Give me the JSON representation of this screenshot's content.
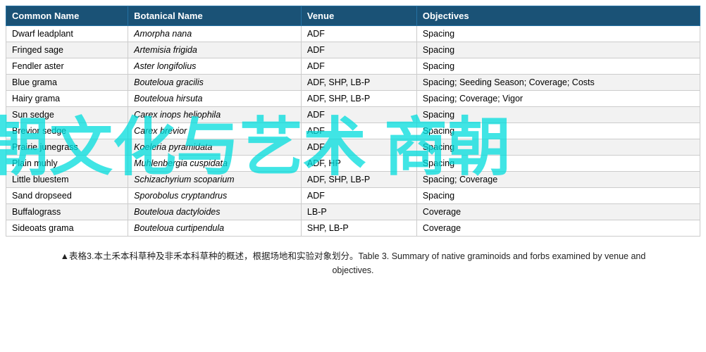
{
  "table": {
    "headers": [
      "Common Name",
      "Botanical  Name",
      "Venue",
      "Objectives"
    ],
    "rows": [
      [
        "Dwarf leadplant",
        "Amorpha nana",
        "ADF",
        "Spacing"
      ],
      [
        "Fringed sage",
        "Artemisia frigida",
        "ADF",
        "Spacing"
      ],
      [
        "Fendler aster",
        "Aster longifolius",
        "ADF",
        "Spacing"
      ],
      [
        "Blue grama",
        "Bouteloua gracilis",
        "ADF, SHP, LB-P",
        "Spacing; Seeding Season;  Coverage; Costs"
      ],
      [
        "Hairy grama",
        "Bouteloua hirsuta",
        "ADF, SHP, LB-P",
        "Spacing; Coverage; Vigor"
      ],
      [
        "Sun sedge",
        "Carex inops heliophila",
        "ADF",
        "Spacing"
      ],
      [
        "Brevior sedge",
        "Carex brevior",
        "ADF",
        "Spacing"
      ],
      [
        "Prairie junegrass",
        "Koeleria pyramidata",
        "ADF",
        "Spacing"
      ],
      [
        "Plain muhly",
        "Muhlenbergia cuspidata",
        "ADF, HP",
        "Spacing"
      ],
      [
        "Little bluestem",
        "Schizachyrium scoparium",
        "ADF, SHP, LB-P",
        "Spacing; Coverage"
      ],
      [
        "Sand dropseed",
        "Sporobolus cryptandrus",
        "ADF",
        "Spacing"
      ],
      [
        "Buffalograss",
        "Bouteloua dactyloides",
        "LB-P",
        "Coverage"
      ],
      [
        "Sideoats grama",
        "Bouteloua curtipendula",
        "SHP, LB-P",
        "Coverage"
      ]
    ]
  },
  "caption": {
    "triangle": "▲",
    "text_cn": "表格3.本土禾本科草种及非禾本科草种的概述，根据场地和实验对象划分。",
    "text_en": "Table 3. Summary of native graminoids and forbs examined by venue and objectives."
  },
  "watermark": "朝文化与艺术  商朝"
}
